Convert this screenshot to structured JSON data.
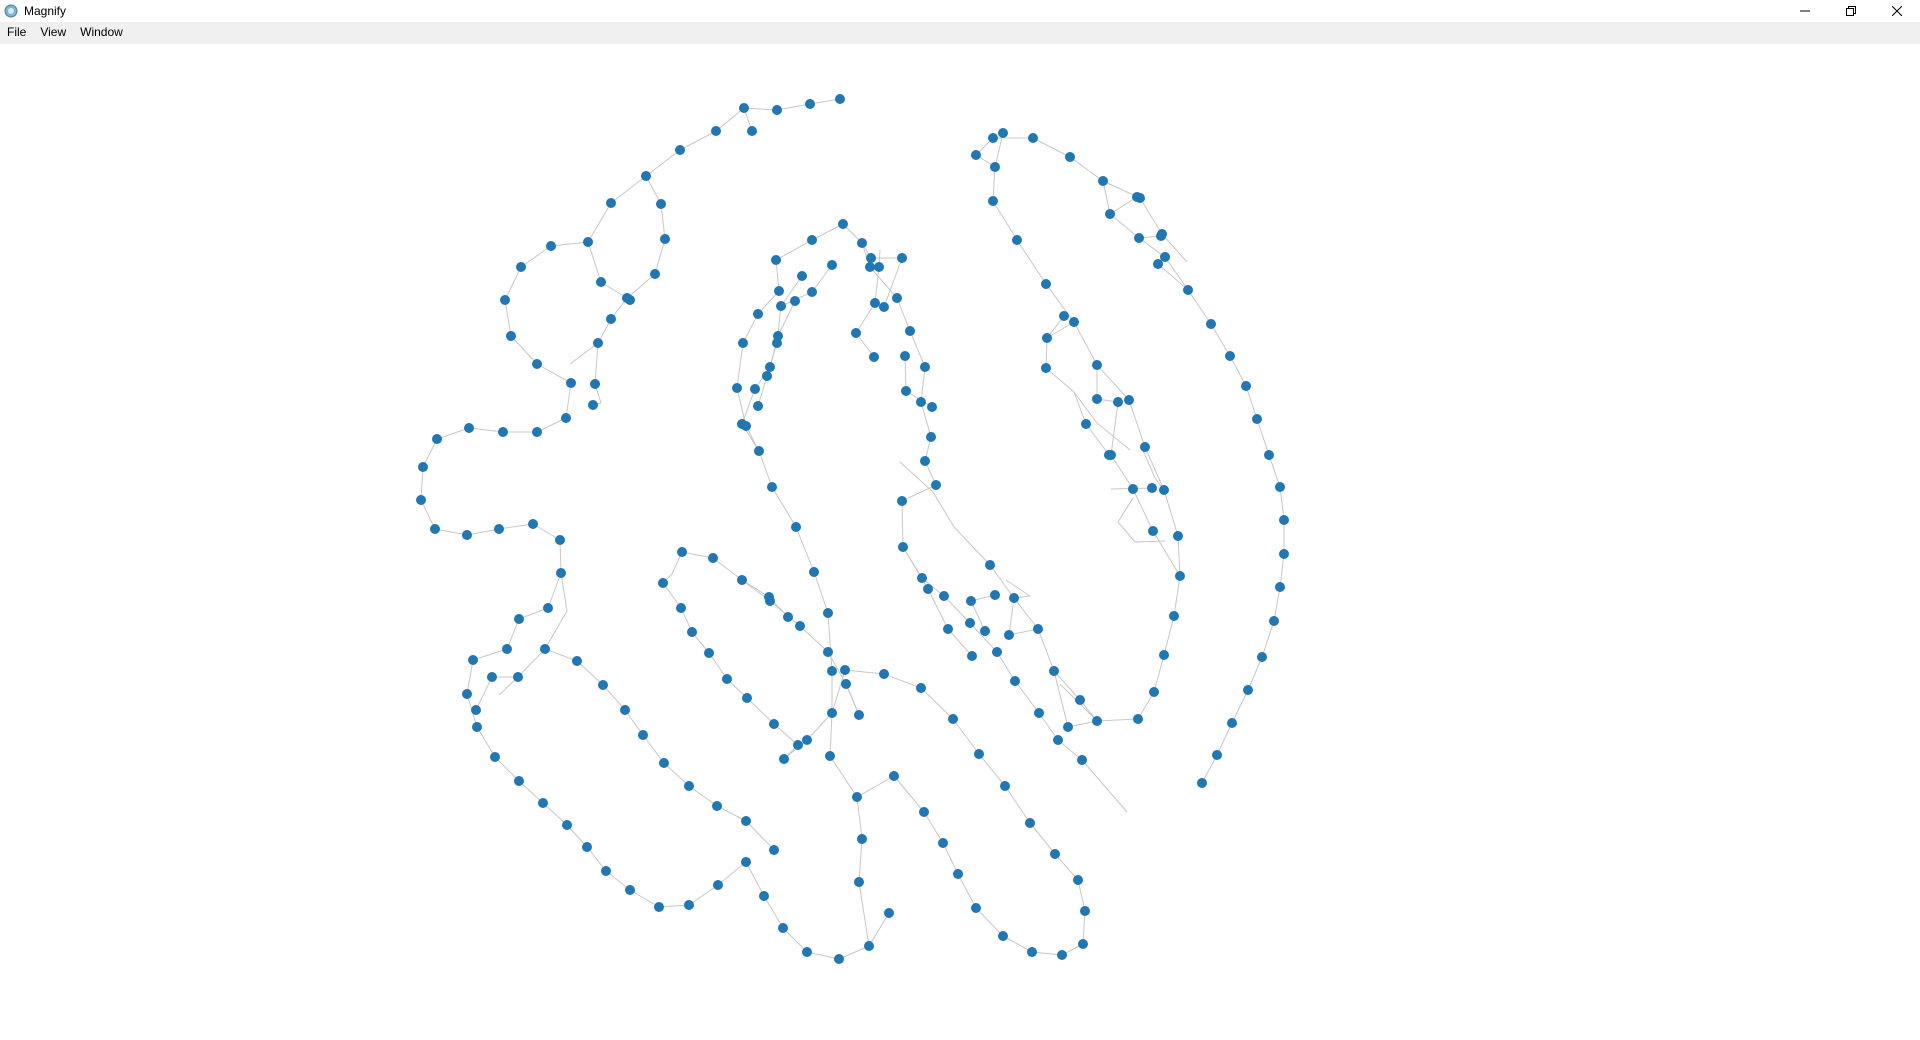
{
  "window": {
    "title": "Magnify",
    "app_icon": "magnify-app-icon",
    "controls": {
      "minimize_icon": "minimize-icon",
      "maximize_icon": "restore-icon",
      "close_icon": "close-icon"
    }
  },
  "menubar": {
    "items": [
      {
        "label": "File"
      },
      {
        "label": "View"
      },
      {
        "label": "Window"
      }
    ]
  },
  "graph": {
    "node_color": "#1f77b4",
    "edge_color": "#c8c8c8"
  }
}
